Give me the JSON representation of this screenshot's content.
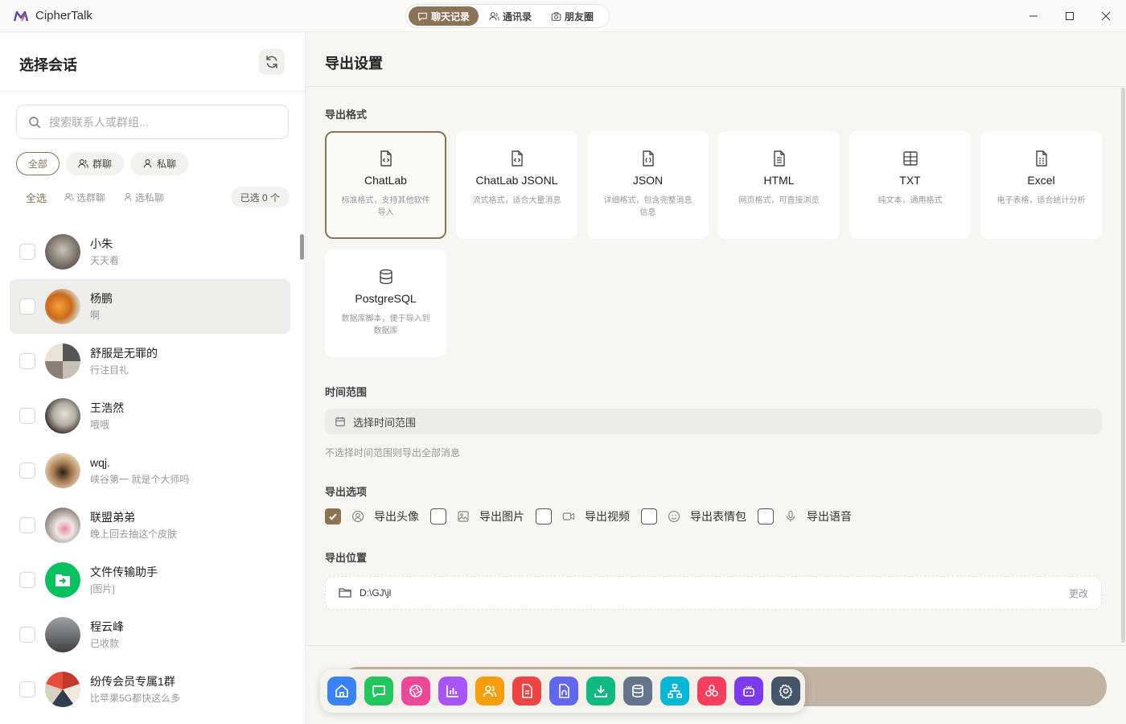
{
  "app": {
    "title": "CipherTalk"
  },
  "top_tabs": [
    {
      "label": "聊天记录",
      "icon": "chat-icon",
      "active": true
    },
    {
      "label": "通讯录",
      "icon": "contacts-icon",
      "active": false
    },
    {
      "label": "朋友圈",
      "icon": "camera-icon",
      "active": false
    }
  ],
  "left": {
    "title": "选择会话",
    "search_placeholder": "搜索联系人或群组...",
    "chips": [
      {
        "label": "全部",
        "active": true
      },
      {
        "label": "群聊",
        "icon": "group-icon"
      },
      {
        "label": "私聊",
        "icon": "person-icon"
      }
    ],
    "select_all": "全选",
    "select_groups": "选群聊",
    "select_private": "选私聊",
    "selected_count": "已选 0 个",
    "contacts": [
      {
        "name": "小朱",
        "msg": "天天看"
      },
      {
        "name": "杨鹏",
        "msg": "啊"
      },
      {
        "name": "舒服是无罪的",
        "msg": "行注目礼"
      },
      {
        "name": "王浩然",
        "msg": "哦哦"
      },
      {
        "name": "wqj.",
        "msg": "峡谷第一 就是个大师吗"
      },
      {
        "name": "联盟弟弟",
        "msg": "晚上回去抽这个皮肤"
      },
      {
        "name": "文件传输助手",
        "msg": "[图片]"
      },
      {
        "name": "程云峰",
        "msg": "已收款"
      },
      {
        "name": "纷传会员专属1群",
        "msg": "比苹果5G都快这么多"
      }
    ]
  },
  "right": {
    "title": "导出设置",
    "format_label": "导出格式",
    "formats": [
      {
        "name": "ChatLab",
        "desc": "标准格式，支持其他软件导入",
        "icon": "file-code-icon",
        "selected": true
      },
      {
        "name": "ChatLab JSONL",
        "desc": "流式格式，适合大量消息",
        "icon": "file-code-icon"
      },
      {
        "name": "JSON",
        "desc": "详细格式，包含完整消息信息",
        "icon": "file-code-icon"
      },
      {
        "name": "HTML",
        "desc": "网页格式，可直接浏览",
        "icon": "file-text-icon"
      },
      {
        "name": "TXT",
        "desc": "纯文本，通用格式",
        "icon": "table-icon"
      },
      {
        "name": "Excel",
        "desc": "电子表格，适合统计分析",
        "icon": "spreadsheet-icon"
      },
      {
        "name": "PostgreSQL",
        "desc": "数据库脚本，便于导入到数据库",
        "icon": "database-icon"
      }
    ],
    "time_label": "时间范围",
    "time_placeholder": "选择时间范围",
    "time_hint": "不选择时间范围则导出全部消息",
    "options_label": "导出选项",
    "options": [
      {
        "label": "导出头像",
        "checked": true,
        "icon": "avatar-icon"
      },
      {
        "label": "导出图片",
        "checked": false,
        "icon": "image-icon"
      },
      {
        "label": "导出视频",
        "checked": false,
        "icon": "video-icon"
      },
      {
        "label": "导出表情包",
        "checked": false,
        "icon": "smile-icon"
      },
      {
        "label": "导出语音",
        "checked": false,
        "icon": "mic-icon"
      }
    ],
    "location_label": "导出位置",
    "path": "D:\\GJ\\jl",
    "change_label": "更改"
  },
  "dock": [
    {
      "name": "home-icon",
      "color": "#3b82f6"
    },
    {
      "name": "chat-icon",
      "color": "#22c55e"
    },
    {
      "name": "aperture-icon",
      "color": "#ec4899"
    },
    {
      "name": "bar-chart-icon",
      "color": "#a855f7"
    },
    {
      "name": "users-icon",
      "color": "#f59e0b"
    },
    {
      "name": "report-icon",
      "color": "#ef4444"
    },
    {
      "name": "headphones-icon",
      "color": "#6366f1"
    },
    {
      "name": "download-icon",
      "color": "#10b981"
    },
    {
      "name": "database-icon",
      "color": "#64748b"
    },
    {
      "name": "sitemap-icon",
      "color": "#06b6d4"
    },
    {
      "name": "network-icon",
      "color": "#f43f5e"
    },
    {
      "name": "bot-icon",
      "color": "#7c3aed"
    },
    {
      "name": "settings-icon",
      "color": "#475569"
    }
  ],
  "colors": {
    "accent": "#8b7355",
    "export_button": "#c2b4a4"
  }
}
